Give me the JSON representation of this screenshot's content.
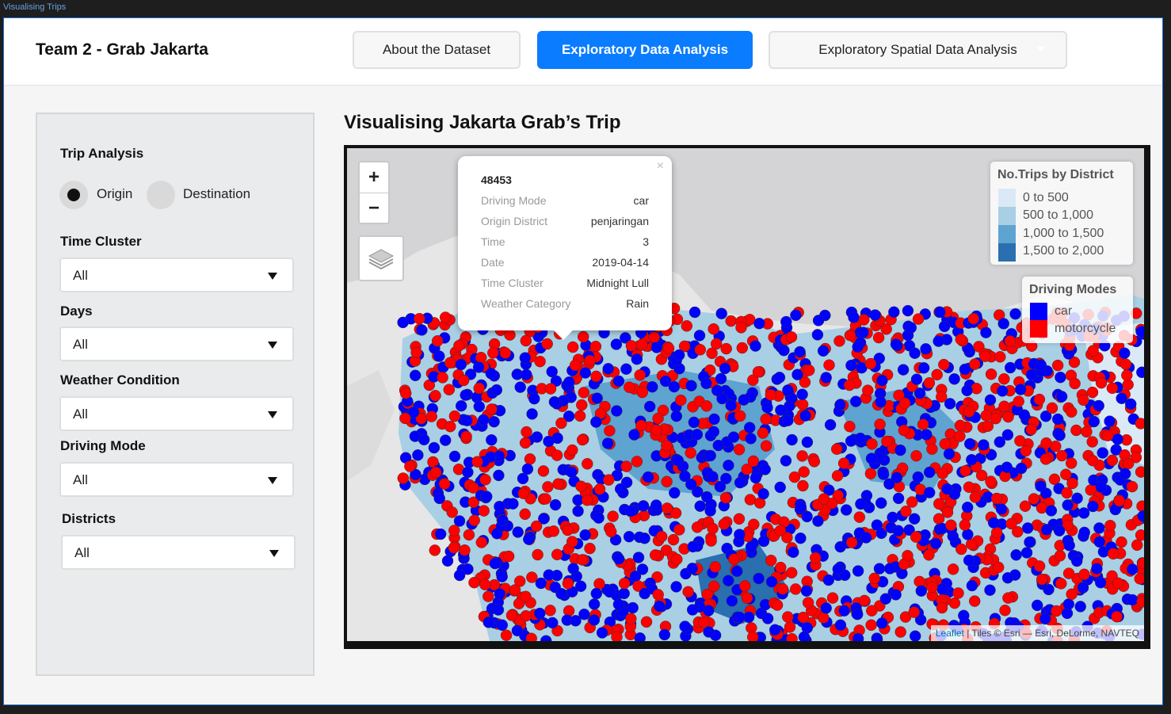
{
  "window": {
    "title": "Visualising Trips"
  },
  "header": {
    "team_title": "Team 2 - Grab Jakarta",
    "tabs": [
      {
        "label": "About the Dataset"
      },
      {
        "label": "Exploratory Data Analysis",
        "active": true
      },
      {
        "label": "Exploratory Spatial Data Analysis",
        "dropdown": true
      }
    ]
  },
  "sidebar": {
    "trip_analysis": {
      "label": "Trip Analysis",
      "options": [
        "Origin",
        "Destination"
      ],
      "selected": "Origin"
    },
    "time_cluster": {
      "label": "Time Cluster",
      "value": "All"
    },
    "days": {
      "label": "Days",
      "value": "All"
    },
    "weather": {
      "label": "Weather Condition",
      "value": "All"
    },
    "driving_mode": {
      "label": "Driving Mode",
      "value": "All"
    },
    "districts": {
      "label": "Districts",
      "value": "All"
    }
  },
  "main": {
    "title": "Visualising Jakarta Grab’s Trip",
    "map": {
      "zoom_in": "+",
      "zoom_out": "−",
      "popup": {
        "close": "×",
        "id": "48453",
        "rows": [
          {
            "key": "Driving Mode",
            "value": "car"
          },
          {
            "key": "Origin District",
            "value": "penjaringan"
          },
          {
            "key": "Time",
            "value": "3"
          },
          {
            "key": "Date",
            "value": "2019-04-14"
          },
          {
            "key": "Time Cluster",
            "value": "Midnight Lull"
          },
          {
            "key": "Weather Category",
            "value": "Rain"
          }
        ]
      },
      "legend_districts": {
        "title": "No.Trips by District",
        "items": [
          {
            "label": "0 to 500",
            "color": "#dbe9f6"
          },
          {
            "label": "500 to 1,000",
            "color": "#a9cfe5"
          },
          {
            "label": "1,000 to 1,500",
            "color": "#5fa3d1"
          },
          {
            "label": "1,500 to 2,000",
            "color": "#2a6fb0"
          }
        ]
      },
      "legend_modes": {
        "title": "Driving Modes",
        "items": [
          {
            "label": "car",
            "color": "#0000ff"
          },
          {
            "label": "motorcycle",
            "color": "#ff0000"
          }
        ]
      },
      "attribution": {
        "link": "Leaflet",
        "text": " | Tiles © Esri — Esri, DeLorme, NAVTEQ"
      }
    }
  },
  "colors": {
    "accent": "#0a7cff",
    "car": "#0000ff",
    "motorcycle": "#ff0000"
  }
}
